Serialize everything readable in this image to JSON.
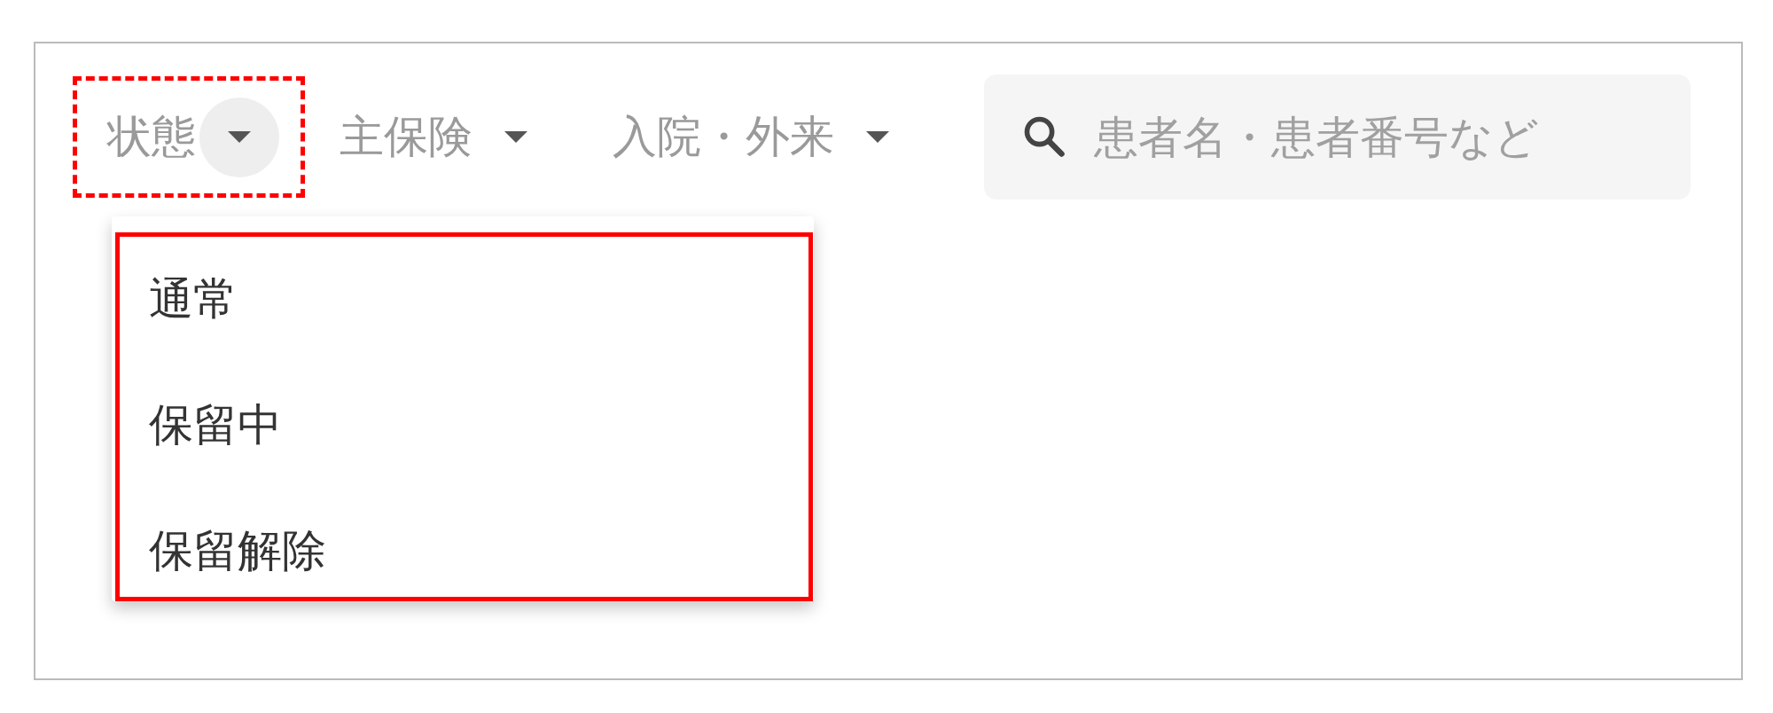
{
  "filters": [
    {
      "label": "状態",
      "expanded": true
    },
    {
      "label": "主保険",
      "expanded": false
    },
    {
      "label": "入院・外来",
      "expanded": false
    }
  ],
  "search": {
    "placeholder": "患者名・患者番号など"
  },
  "dropdown": {
    "items": [
      "通常",
      "保留中",
      "保留解除"
    ]
  }
}
